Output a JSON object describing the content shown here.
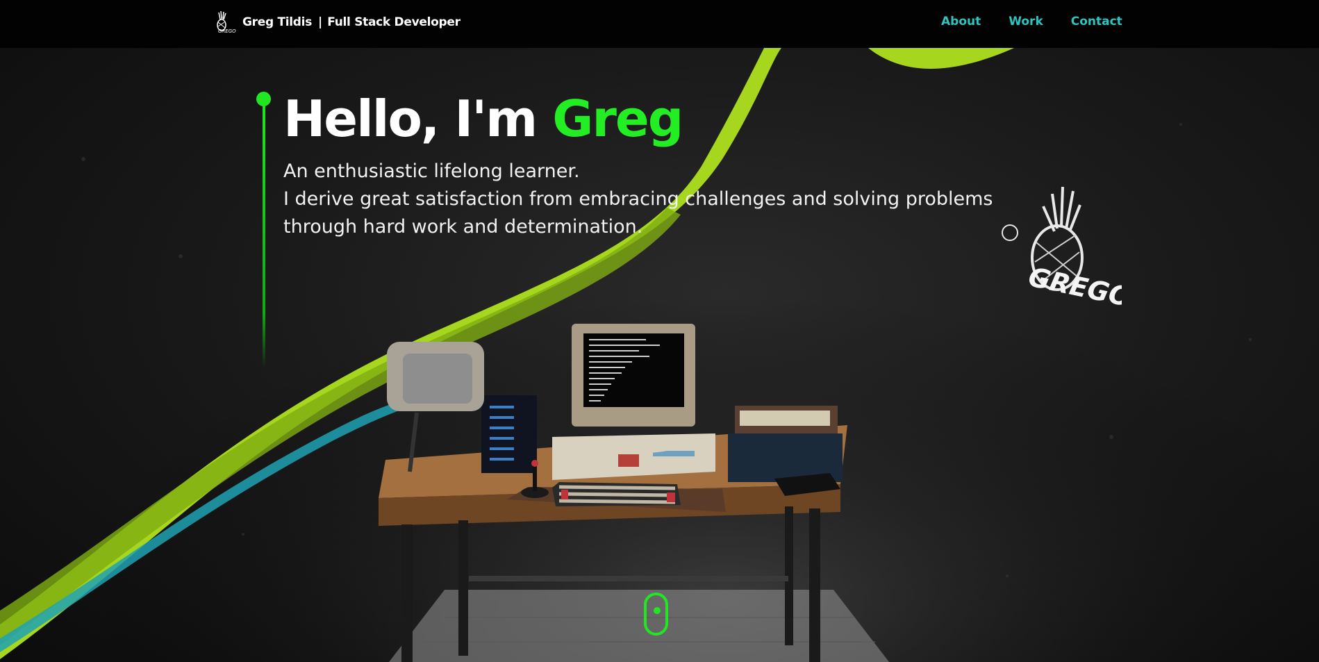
{
  "header": {
    "name": "Greg Tildis",
    "separator": "|",
    "role": "Full Stack Developer",
    "logo_text": "GREGO"
  },
  "nav": {
    "items": [
      {
        "label": "About"
      },
      {
        "label": "Work"
      },
      {
        "label": "Contact"
      }
    ]
  },
  "hero": {
    "greeting": "Hello, I'm ",
    "name_highlight": "Greg",
    "tagline_line1": "An enthusiastic lifelong learner.",
    "tagline_line2": "I derive great satisfaction from embracing challenges and solving problems",
    "tagline_line3": "through hard work and determination.",
    "logo_label": "GREGO"
  },
  "colors": {
    "accent_green": "#23ee23",
    "nav_link": "#2ec4c0",
    "ribbon_green": "#a6d61e",
    "background": "#000000"
  }
}
